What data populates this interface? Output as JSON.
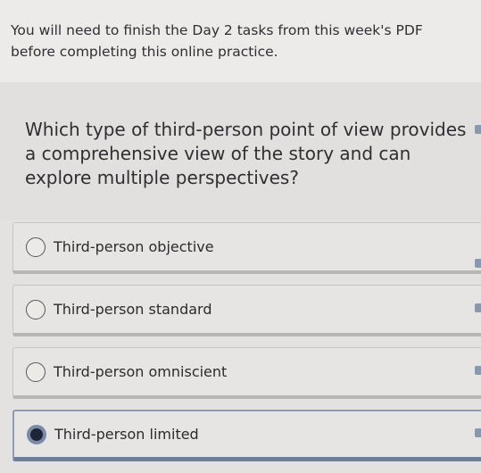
{
  "instructions": {
    "text": "You will need to finish the Day 2 tasks from this week's PDF before completing this online practice."
  },
  "question": {
    "text": "Which type of third-person point of view provides a comprehensive view of the story and can explore multiple perspectives?"
  },
  "options": [
    {
      "label": "Third-person objective",
      "selected": false
    },
    {
      "label": "Third-person standard",
      "selected": false
    },
    {
      "label": "Third-person omniscient",
      "selected": false
    },
    {
      "label": "Third-person limited",
      "selected": true
    }
  ],
  "colors": {
    "accent": "#7a8aa6",
    "selected_fill": "#1e2538"
  }
}
